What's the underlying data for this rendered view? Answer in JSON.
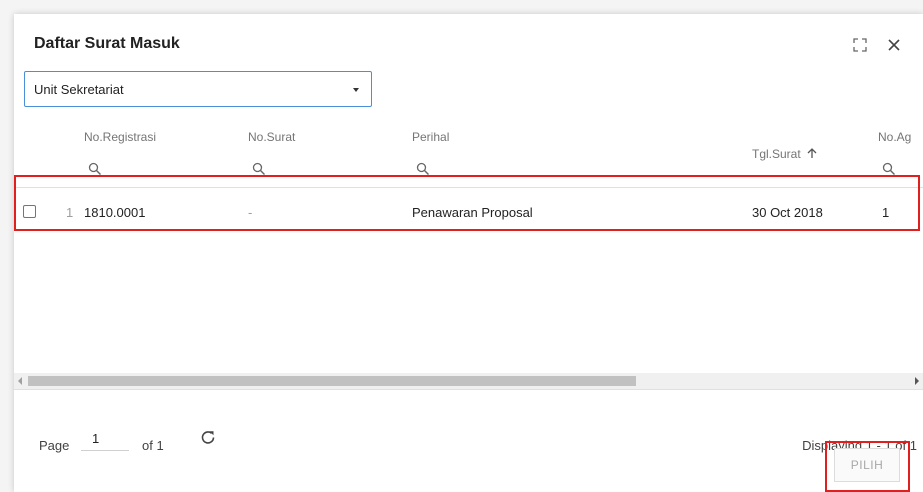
{
  "dialog": {
    "title": "Daftar Surat Masuk",
    "icons": {
      "maximize": "maximize-icon",
      "close": "close-icon"
    }
  },
  "unit_select": {
    "value": "Unit Sekretariat",
    "icon": "dropdown-arrow-icon"
  },
  "grid": {
    "columns": [
      {
        "label": "No.Registrasi",
        "searchable": true
      },
      {
        "label": "No.Surat",
        "searchable": true
      },
      {
        "label": "Perihal",
        "searchable": true
      },
      {
        "label": "Tgl.Surat",
        "sort": "ascending",
        "sort_icon": "arrow-up-icon"
      },
      {
        "label": "No.Ag",
        "searchable": true
      }
    ],
    "rows": [
      {
        "rownum": "1",
        "no_registrasi": "1810.0001",
        "no_surat": "-",
        "perihal": "Penawaran Proposal",
        "tgl_surat": "30 Oct 2018",
        "no_agenda": "1",
        "selected": false
      }
    ]
  },
  "pager": {
    "page_label": "Page",
    "page_value": "1",
    "of_label": "of 1",
    "refresh_icon": "refresh-icon",
    "displaying": "Displaying 1 - 1 of 1"
  },
  "actions": {
    "pilih_label": "PILIH"
  },
  "colors": {
    "highlight": "#e01f1f",
    "focus_border": "#4a90d9"
  }
}
